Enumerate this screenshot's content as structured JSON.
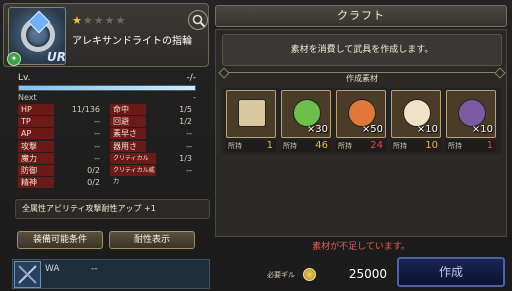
{
  "item": {
    "stars_filled": 1,
    "stars_total": 5,
    "name": "アレキサンドライトの指輪",
    "rarity": "UR",
    "icon": "ring-icon"
  },
  "level": {
    "label": "Lv.",
    "value": "-/-",
    "next_label": "Next",
    "next_value": "-",
    "progress": 1.0
  },
  "stats": [
    {
      "label": "HP",
      "value": "11/136"
    },
    {
      "label": "命中",
      "value": "1/5"
    },
    {
      "label": "TP",
      "value": "--"
    },
    {
      "label": "回避",
      "value": "1/2"
    },
    {
      "label": "AP",
      "value": "--"
    },
    {
      "label": "素早さ",
      "value": "--"
    },
    {
      "label": "攻撃",
      "value": "--"
    },
    {
      "label": "器用さ",
      "value": "--"
    },
    {
      "label": "魔力",
      "value": "--"
    },
    {
      "label": "クリティカル",
      "value": "1/3"
    },
    {
      "label": "防御",
      "value": "0/2"
    },
    {
      "label": "クリティカル威力",
      "value": "--"
    },
    {
      "label": "精神",
      "value": "0/2"
    }
  ],
  "effect_text": "全属性アビリティ攻撃耐性アップ +1",
  "buttons": {
    "equip_conditions": "装備可能条件",
    "resistance_display": "耐性表示",
    "create": "作成"
  },
  "wa": {
    "label": "WA",
    "value": "--"
  },
  "craft": {
    "title": "クラフト",
    "description": "素材を消費して武具を作成します。",
    "materials_header": "作成素材",
    "owned_label": "所持",
    "materials": [
      {
        "name": "scroll",
        "qty": "",
        "owned": "1",
        "ok": true,
        "color": "#d9c7a0"
      },
      {
        "name": "green-mask",
        "qty": "×30",
        "owned": "46",
        "ok": true,
        "color": "#6bbf4a"
      },
      {
        "name": "orange-mask",
        "qty": "×50",
        "owned": "24",
        "ok": false,
        "color": "#e0783a"
      },
      {
        "name": "horn",
        "qty": "×10",
        "owned": "10",
        "ok": true,
        "color": "#efe2c6"
      },
      {
        "name": "dark-crystal",
        "qty": "×10",
        "owned": "1",
        "ok": false,
        "color": "#7a5aa0"
      }
    ],
    "insufficient_text": "素材が不足しています。",
    "cost_label": "必要ギル",
    "cost_value": "25000"
  },
  "colors": {
    "accent_red": "#6b1a18",
    "owned_ok": "#e6b24a",
    "owned_bad": "#e64848",
    "create_button": "#1a2550"
  }
}
